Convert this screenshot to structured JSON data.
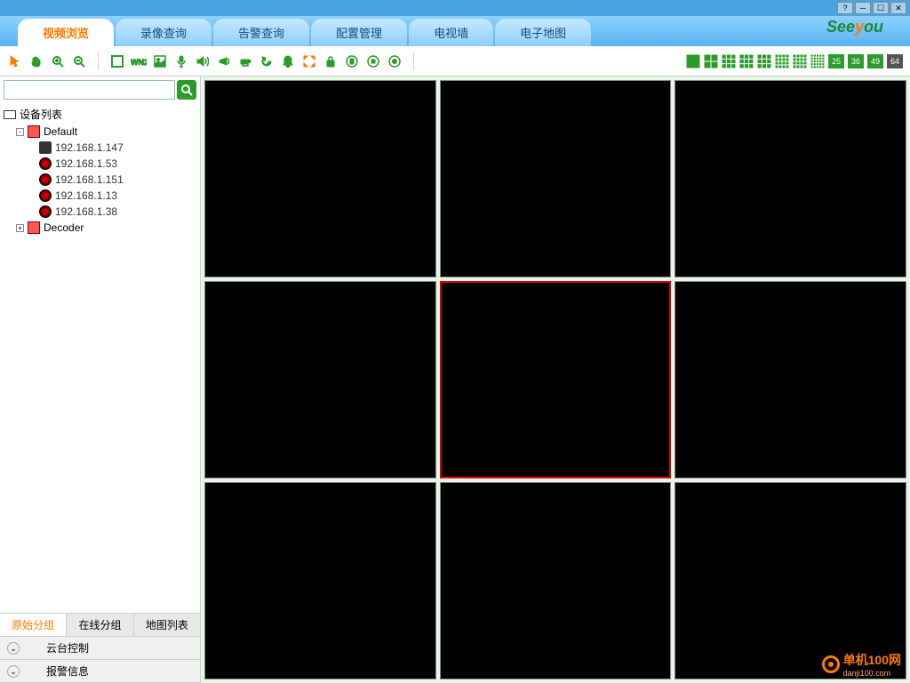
{
  "tabs": [
    "视频浏览",
    "录像查询",
    "告警查询",
    "配置管理",
    "电视墙",
    "电子地图"
  ],
  "active_tab": 0,
  "logo_text": "Seeyou",
  "layout_numbers": [
    "25",
    "36",
    "49",
    "64"
  ],
  "layout_dark_idx": 3,
  "search_placeholder": "",
  "tree": {
    "root": "设备列表",
    "groups": [
      {
        "name": "Default",
        "devices": [
          "192.168.1.147",
          "192.168.1.53",
          "192.168.1.151",
          "192.168.1.13",
          "192.168.1.38"
        ],
        "first_type": "dev"
      },
      {
        "name": "Decoder",
        "devices": []
      }
    ]
  },
  "side_tabs": [
    "原始分组",
    "在线分组",
    "地图列表"
  ],
  "side_tab_active": 0,
  "accordion": [
    "云台控制",
    "报警信息"
  ],
  "grid": {
    "rows": 3,
    "cols": 3,
    "selected": 4
  },
  "watermark": {
    "title": "单机100网",
    "sub": "danji100.com"
  }
}
